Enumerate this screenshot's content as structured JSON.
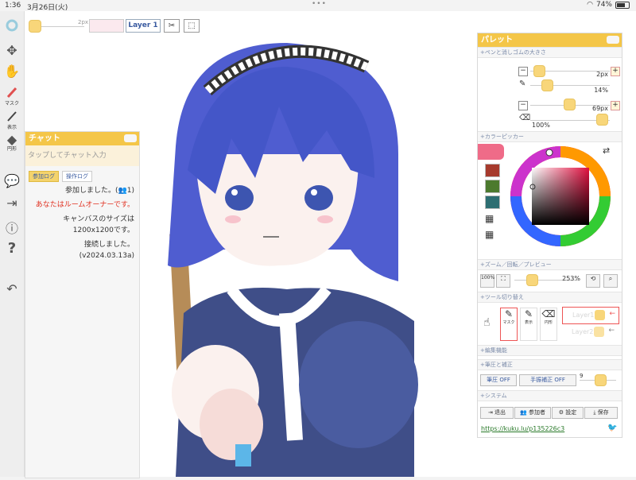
{
  "status": {
    "time": "1:36",
    "date": "3月26日(火)",
    "dots": "•••",
    "battery": "74%"
  },
  "left_tools": {
    "mask": "マスク",
    "view": "表示",
    "shape": "円形"
  },
  "topbar": {
    "size_label": "2px",
    "layer_button": "Layer 1"
  },
  "chat": {
    "title": "チャット",
    "input_placeholder": "タップしてチャット入力",
    "tabs": [
      "参加ログ",
      "操作ログ"
    ],
    "messages": [
      {
        "text": "参加しました。(👥1)",
        "color": "normal"
      },
      {
        "text": "あなたはルームオーナーです。",
        "color": "red"
      },
      {
        "text": "キャンバスのサイズは1200x1200です。",
        "color": "normal"
      },
      {
        "text": "接続しました。(v2024.03.13a)",
        "color": "normal"
      }
    ]
  },
  "palette": {
    "title": "パレット",
    "sections": {
      "pen_size": "+ペンと消しゴムの大きさ",
      "color_picker": "+カラーピッカー",
      "zoom": "+ズーム／回転／プレビュー",
      "tool_switch": "+ツール切り替え",
      "edit": "+編集機能",
      "pressure": "+筆圧と補正",
      "system": "+システム"
    },
    "pen_size": {
      "value": "2px",
      "opacity": "14%"
    },
    "eraser_size": {
      "value": "69px",
      "opacity": "100%"
    },
    "zoom": {
      "value": "253%",
      "zoom_btn": "100%"
    },
    "tools": {
      "mask": "マスク",
      "view": "表示",
      "shape": "円形"
    },
    "layers": [
      "Layer1",
      "Layer2"
    ],
    "pressure": {
      "off": "筆圧 OFF",
      "hand_off": "手振補正 OFF",
      "value": "9"
    },
    "system": {
      "exit": "退出",
      "participants": "参加者",
      "settings": "設定",
      "save": "保存"
    },
    "link": "https://kuku.lu/p135226c3"
  },
  "colors": {
    "accent": "#f4c648",
    "current": "#ef6b88",
    "swatches": [
      "#a63a2c",
      "#4c7a2e",
      "#2d6e72"
    ]
  }
}
